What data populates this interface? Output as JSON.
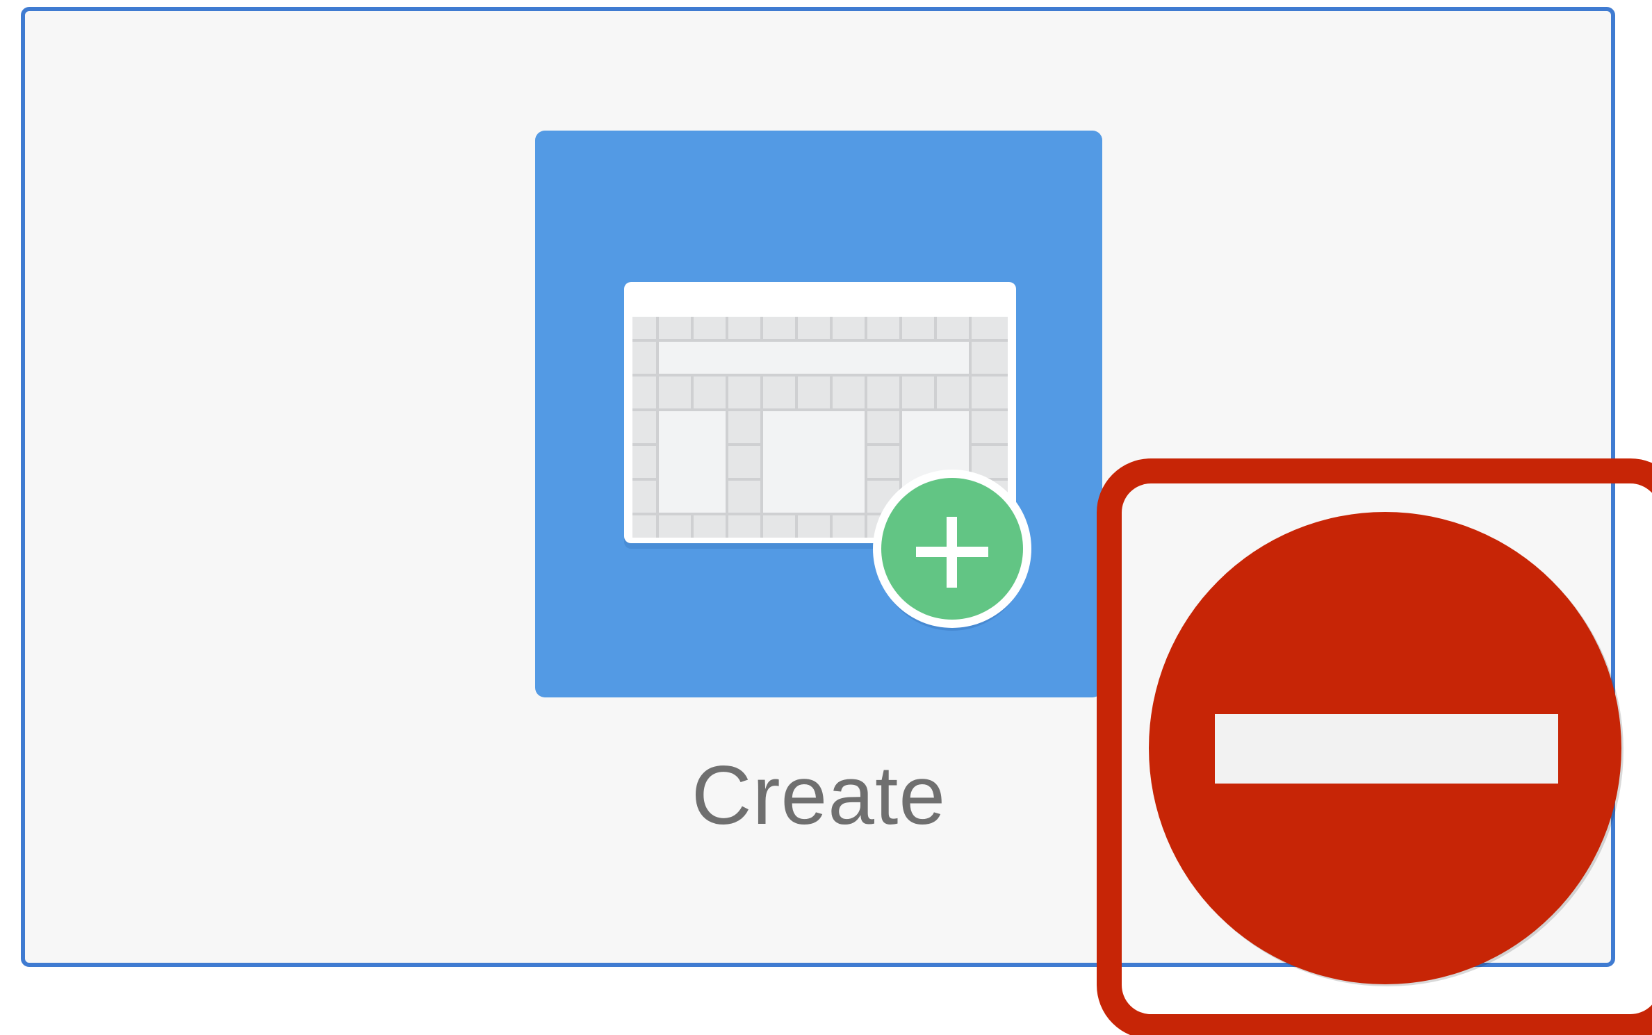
{
  "card": {
    "label": "Create"
  },
  "icons": {
    "tile_icon": "spreadsheet-add-icon",
    "badge_icon": "plus-icon",
    "overlay_icon": "no-entry-icon"
  },
  "colors": {
    "card_border": "#3f7bd1",
    "tile_background": "#539ae4",
    "badge_green": "#62c584",
    "overlay_red": "#c72506"
  }
}
